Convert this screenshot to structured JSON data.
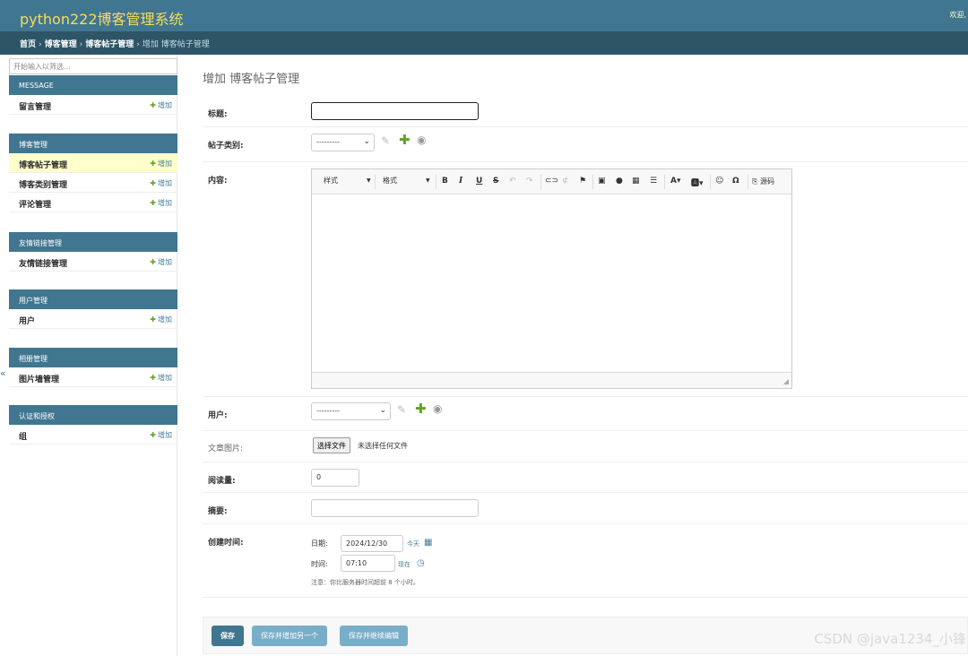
{
  "header": {
    "site_title": "python222博客管理系统",
    "welcome": "欢迎,"
  },
  "breadcrumbs": {
    "items": [
      "首页",
      "博客管理",
      "博客帖子管理"
    ],
    "current": "增加 博客帖子管理"
  },
  "sidebar": {
    "filter_placeholder": "开始输入以筛选...",
    "collapse_glyph": "«",
    "add_label": "增加",
    "modules": [
      {
        "caption": "MESSAGE",
        "models": [
          {
            "name": "留言管理",
            "active": false
          }
        ]
      },
      {
        "caption": "博客管理",
        "models": [
          {
            "name": "博客帖子管理",
            "active": true
          },
          {
            "name": "博客类别管理",
            "active": false
          },
          {
            "name": "评论管理",
            "active": false
          }
        ]
      },
      {
        "caption": "友情链接管理",
        "models": [
          {
            "name": "友情链接管理",
            "active": false
          }
        ]
      },
      {
        "caption": "用户管理",
        "models": [
          {
            "name": "用户",
            "active": false
          }
        ]
      },
      {
        "caption": "相册管理",
        "models": [
          {
            "name": "图片墙管理",
            "active": false
          }
        ]
      },
      {
        "caption": "认证和授权",
        "models": [
          {
            "name": "组",
            "active": false
          }
        ]
      }
    ]
  },
  "form": {
    "page_title": "增加 博客帖子管理",
    "fields": {
      "title": {
        "label": "标题:",
        "value": ""
      },
      "category": {
        "label": "帖子类别:",
        "value": "---------"
      },
      "content": {
        "label": "内容:",
        "toolbar": {
          "styles_combo": "样式",
          "format_combo": "格式",
          "bold": "B",
          "italic": "I",
          "underline": "U",
          "strike": "S",
          "source": "源码"
        }
      },
      "user": {
        "label": "用户:",
        "value": "---------"
      },
      "image": {
        "label": "文章图片:",
        "button": "选择文件",
        "status": "未选择任何文件"
      },
      "views": {
        "label": "阅读量:",
        "value": "0"
      },
      "summary": {
        "label": "摘要:",
        "value": ""
      },
      "created": {
        "label": "创建时间:",
        "date_label": "日期:",
        "date_value": "2024/12/30",
        "today_link": "今天",
        "time_label": "时间:",
        "time_value": "07:10",
        "now_link": "现在",
        "note": "注意：你比服务器时间超前 8 个小时。"
      }
    },
    "buttons": {
      "save": "保存",
      "save_add": "保存并增加另一个",
      "save_continue": "保存并继续编辑"
    }
  },
  "watermark": "CSDN @java1234_小锋",
  "colors": {
    "header_bg": "#417690",
    "breadcrumb_bg": "#2e5566",
    "title_yellow": "#f5dd5d",
    "active_row": "#ffffcc",
    "add_green": "#5fa225",
    "button_blue": "#79aec8"
  },
  "icons": [
    "pencil-icon",
    "plus-icon",
    "eye-icon",
    "calendar-icon",
    "clock-icon"
  ]
}
